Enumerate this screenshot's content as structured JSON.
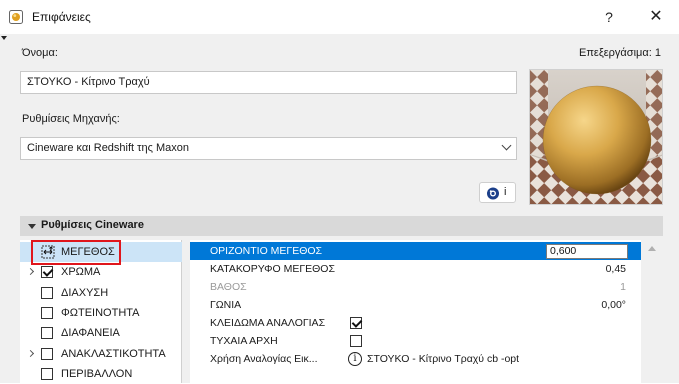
{
  "window": {
    "title": "Επιφάνειες",
    "help_label": "?",
    "close_label": "✕"
  },
  "name": {
    "label": "Όνομα:",
    "value": "ΣΤΟΥΚΟ - Κίτρινο Τραχύ",
    "edit_count": "Επεξεργάσιμα: 1"
  },
  "engine": {
    "label": "Ρυθμίσεις Μηχανής:",
    "selected": "Cineware και Redshift της Maxon"
  },
  "info_button": {
    "label": "i"
  },
  "section": {
    "title": "Ρυθμίσεις Cineware"
  },
  "channels": [
    {
      "label": "ΜΕΓΕΘΟΣ",
      "checked": null,
      "expandable": false,
      "selected": true
    },
    {
      "label": "ΧΡΩΜΑ",
      "checked": true,
      "expandable": true,
      "selected": false
    },
    {
      "label": "ΔΙΑΧΥΣΗ",
      "checked": false,
      "expandable": false,
      "selected": false
    },
    {
      "label": "ΦΩΤΕΙΝΟΤΗΤΑ",
      "checked": false,
      "expandable": false,
      "selected": false
    },
    {
      "label": "ΔΙΑΦΑΝΕΙΑ",
      "checked": false,
      "expandable": false,
      "selected": false
    },
    {
      "label": "ΑΝΑΚΛΑΣΤΙΚΟΤΗΤΑ",
      "checked": false,
      "expandable": true,
      "selected": false
    },
    {
      "label": "ΠΕΡΙΒΑΛΛΟΝ",
      "checked": false,
      "expandable": false,
      "selected": false
    }
  ],
  "properties": [
    {
      "name": "ΟΡΙΖΟΝΤΙΟ ΜΕΓΕΘΟΣ",
      "value": "0,600",
      "kind": "edit"
    },
    {
      "name": "ΚΑΤΑΚΟΡΥΦΟ ΜΕΓΕΘΟΣ",
      "value": "0,45",
      "kind": "text"
    },
    {
      "name": "ΒΑΘΟΣ",
      "value": "1",
      "kind": "disabled"
    },
    {
      "name": "ΓΩΝΙΑ",
      "value": "0,00°",
      "kind": "text"
    },
    {
      "name": "ΚΛΕΙΔΩΜΑ ΑΝΑΛΟΓΙΑΣ",
      "value": "",
      "kind": "checkbox",
      "checked": true
    },
    {
      "name": "ΤΥΧΑΙΑ ΑΡΧΗ",
      "value": "",
      "kind": "checkbox",
      "checked": false
    },
    {
      "name": "Χρήση Αναλογίας Εικ...",
      "value": "ΣΤΟΥΚΟ - Κίτρινο Τραχύ cb -opt",
      "kind": "info"
    }
  ],
  "colors": {
    "accent": "#0078d7",
    "tree_selection": "#cce4f7",
    "highlight_box": "#e0161c",
    "section_bar": "#d9d9d9"
  },
  "icons": {
    "app": "sphere-preview-icon",
    "info": "cineware-info-icon",
    "size": "resize-arrows-icon"
  }
}
